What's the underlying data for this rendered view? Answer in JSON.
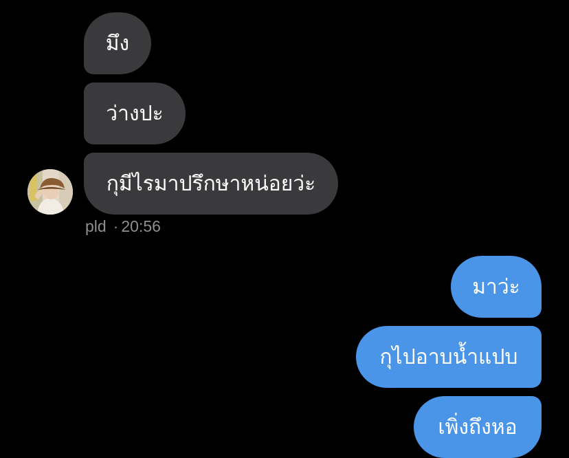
{
  "incoming": {
    "messages": [
      {
        "text": "มึง"
      },
      {
        "text": "ว่างปะ"
      },
      {
        "text": "กุมีไรมาปรึกษาหน่อยว่ะ"
      }
    ],
    "sender": "pld",
    "time": "20:56",
    "avatar_icon": "profile-photo"
  },
  "outgoing": {
    "messages": [
      {
        "text": "มาว่ะ"
      },
      {
        "text": "กุไปอาบน้ำแปบ"
      },
      {
        "text": "เพิ่งถึงหอ"
      }
    ]
  },
  "colors": {
    "background": "#000000",
    "incoming_bubble": "#3a3a3c",
    "outgoing_bubble": "#4a95e8",
    "meta_text": "#8e8e93"
  }
}
